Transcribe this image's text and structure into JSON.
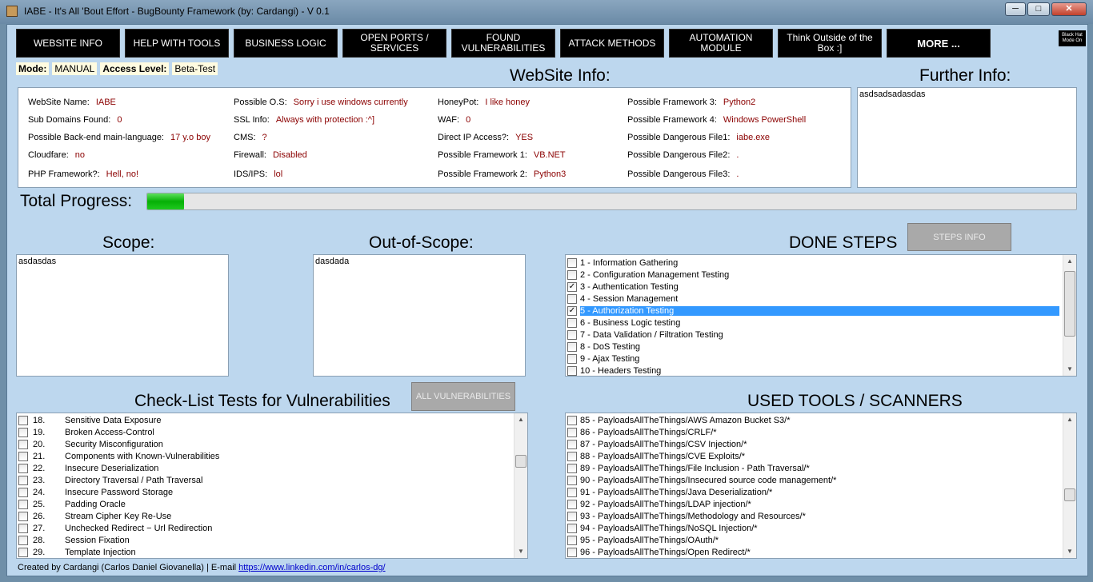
{
  "window": {
    "title": "IABE - It's All 'Bout Effort - BugBounty Framework (by: Cardangi) - V 0.1",
    "minimize": "─",
    "maximize": "□",
    "close": "✕"
  },
  "nav": [
    "WEBSITE INFO",
    "HELP WITH TOOLS",
    "BUSINESS LOGIC",
    "OPEN PORTS / SERVICES",
    "FOUND VULNERABILITIES",
    "ATTACK METHODS",
    "AUTOMATION MODULE",
    "Think Outside of the Box :]",
    "MORE ..."
  ],
  "black_hat": "Black Hat Mode On",
  "mode": {
    "label": "Mode:",
    "value": "MANUAL",
    "access_label": "Access Level:",
    "access_value": "Beta-Test"
  },
  "website_info": {
    "title": "WebSite Info:",
    "fields": [
      {
        "label": "WebSite Name:",
        "value": "IABE"
      },
      {
        "label": "Sub Domains Found:",
        "value": "0"
      },
      {
        "label": "Possible Back-end main-language:",
        "value": "17 y.o boy"
      },
      {
        "label": "Cloudfare:",
        "value": "no"
      },
      {
        "label": "PHP Framework?:",
        "value": "Hell, no!"
      },
      {
        "label": "Possible O.S:",
        "value": "Sorry i use windows currently"
      },
      {
        "label": "SSL Info:",
        "value": "Always with protection :^]"
      },
      {
        "label": "CMS:",
        "value": "?"
      },
      {
        "label": "Firewall:",
        "value": "Disabled"
      },
      {
        "label": "IDS/IPS:",
        "value": "lol"
      },
      {
        "label": "HoneyPot:",
        "value": "I like honey"
      },
      {
        "label": "WAF:",
        "value": "0"
      },
      {
        "label": "Direct IP Access?:",
        "value": "YES"
      },
      {
        "label": "Possible Framework 1:",
        "value": "VB.NET"
      },
      {
        "label": "Possible Framework 2:",
        "value": "Python3"
      },
      {
        "label": "Possible Framework 3:",
        "value": "Python2"
      },
      {
        "label": "Possible Framework 4:",
        "value": "Windows PowerShell"
      },
      {
        "label": "Possible Dangerous File1:",
        "value": "iabe.exe"
      },
      {
        "label": "Possible Dangerous File2:",
        "value": "."
      },
      {
        "label": "Possible Dangerous File3:",
        "value": "."
      }
    ]
  },
  "further": {
    "title": "Further Info:",
    "text": "asdsadsadasdas"
  },
  "progress": {
    "label": "Total Progress:",
    "value": 0.04
  },
  "scope": {
    "title": "Scope:",
    "text": "asdasdas"
  },
  "out_scope": {
    "title": "Out-of-Scope:",
    "text": "dasdada"
  },
  "done_steps": {
    "title": "DONE STEPS",
    "button": "STEPS INFO",
    "items": [
      {
        "label": "1 - Information Gathering",
        "checked": false,
        "selected": false
      },
      {
        "label": "2 - Configuration Management Testing",
        "checked": false,
        "selected": false
      },
      {
        "label": "3 - Authentication Testing",
        "checked": true,
        "selected": false
      },
      {
        "label": "4 - Session Management",
        "checked": false,
        "selected": false
      },
      {
        "label": "5 - Authorization Testing",
        "checked": true,
        "selected": true
      },
      {
        "label": "6 - Business Logic testing",
        "checked": false,
        "selected": false
      },
      {
        "label": "7 - Data Validation / Filtration Testing",
        "checked": false,
        "selected": false
      },
      {
        "label": "8 - DoS Testing",
        "checked": false,
        "selected": false
      },
      {
        "label": "9 - Ajax Testing",
        "checked": false,
        "selected": false
      },
      {
        "label": "10 - Headers Testing",
        "checked": false,
        "selected": false
      }
    ]
  },
  "checklist": {
    "title": "Check-List Tests for Vulnerabilities",
    "button": "ALL VULNERABILITIES",
    "items": [
      {
        "num": "18.",
        "label": "Sensitive Data Exposure"
      },
      {
        "num": "19.",
        "label": "Broken Access-Control"
      },
      {
        "num": "20.",
        "label": "Security Misconfiguration"
      },
      {
        "num": "21.",
        "label": "Components with Known-Vulnerabilities"
      },
      {
        "num": "22.",
        "label": "Insecure Deserialization"
      },
      {
        "num": "23.",
        "label": "Directory Traversal / Path Traversal"
      },
      {
        "num": "24.",
        "label": "Insecure Password Storage"
      },
      {
        "num": "25.",
        "label": "Padding Oracle"
      },
      {
        "num": "26.",
        "label": "Stream Cipher Key Re-Use"
      },
      {
        "num": "27.",
        "label": "Unchecked Redirect − Url Redirection"
      },
      {
        "num": "28.",
        "label": "Session Fixation"
      },
      {
        "num": "29.",
        "label": "Template Injection"
      }
    ]
  },
  "tools": {
    "title": "USED TOOLS / SCANNERS",
    "items": [
      "85 - PayloadsAllTheThings/AWS Amazon Bucket S3/*",
      "86 - PayloadsAllTheThings/CRLF/*",
      "87 - PayloadsAllTheThings/CSV Injection/*",
      "88 - PayloadsAllTheThings/CVE Exploits/*",
      "89 - PayloadsAllTheThings/File Inclusion - Path Traversal/*",
      "90 - PayloadsAllTheThings/Insecured source code management/*",
      "91 - PayloadsAllTheThings/Java Deserialization/*",
      "92 - PayloadsAllTheThings/LDAP injection/*",
      "93 - PayloadsAllTheThings/Methodology and Resources/*",
      "94 - PayloadsAllTheThings/NoSQL Injection/*",
      "95 - PayloadsAllTheThings/OAuth/*",
      "96 - PayloadsAllTheThings/Open Redirect/*"
    ]
  },
  "footer": {
    "text": "Created by Cardangi (Carlos Daniel Giovanella) | E-mail ",
    "link": "https://www.linkedin.com/in/carlos-dg/"
  }
}
